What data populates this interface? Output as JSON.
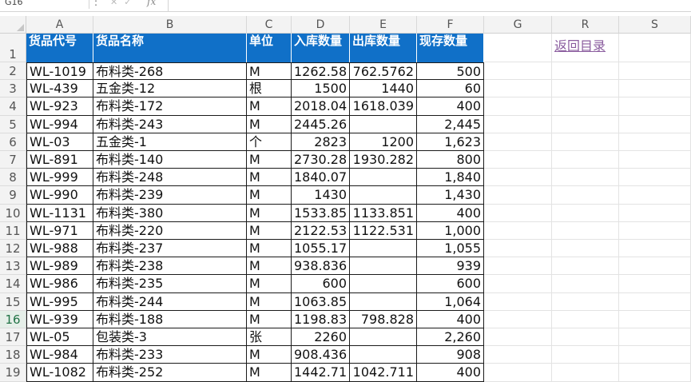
{
  "formula_bar": {
    "cell_ref": "G16",
    "fx": "fx",
    "formula": ""
  },
  "columns": [
    "A",
    "B",
    "C",
    "D",
    "E",
    "F",
    "G",
    "R",
    "S"
  ],
  "headers": [
    "货品代号",
    "货品名称",
    "单位",
    "入库数量",
    "出库数量",
    "现存数量"
  ],
  "link_text": "返回目录",
  "active_row": 16,
  "rows": [
    {
      "n": "2",
      "code": "WL-1019",
      "name": "布料类-268",
      "unit": "M",
      "in": "1262.58",
      "out": "762.5762",
      "stock": "500"
    },
    {
      "n": "3",
      "code": "WL-439",
      "name": "五金类-12",
      "unit": "根",
      "in": "1500",
      "out": "1440",
      "stock": "60"
    },
    {
      "n": "4",
      "code": "WL-923",
      "name": "布料类-172",
      "unit": "M",
      "in": "2018.04",
      "out": "1618.039",
      "stock": "400"
    },
    {
      "n": "5",
      "code": "WL-994",
      "name": "布料类-243",
      "unit": "M",
      "in": "2445.26",
      "out": "",
      "stock": "2,445"
    },
    {
      "n": "6",
      "code": "WL-03",
      "name": "五金类-1",
      "unit": "个",
      "in": "2823",
      "out": "1200",
      "stock": "1,623"
    },
    {
      "n": "7",
      "code": "WL-891",
      "name": "布料类-140",
      "unit": "M",
      "in": "2730.28",
      "out": "1930.282",
      "stock": "800"
    },
    {
      "n": "8",
      "code": "WL-999",
      "name": "布料类-248",
      "unit": "M",
      "in": "1840.07",
      "out": "",
      "stock": "1,840"
    },
    {
      "n": "9",
      "code": "WL-990",
      "name": "布料类-239",
      "unit": "M",
      "in": "1430",
      "out": "",
      "stock": "1,430"
    },
    {
      "n": "10",
      "code": "WL-1131",
      "name": "布料类-380",
      "unit": "M",
      "in": "1533.85",
      "out": "1133.851",
      "stock": "400"
    },
    {
      "n": "11",
      "code": "WL-971",
      "name": "布料类-220",
      "unit": "M",
      "in": "2122.53",
      "out": "1122.531",
      "stock": "1,000"
    },
    {
      "n": "12",
      "code": "WL-988",
      "name": "布料类-237",
      "unit": "M",
      "in": "1055.17",
      "out": "",
      "stock": "1,055"
    },
    {
      "n": "13",
      "code": "WL-989",
      "name": "布料类-238",
      "unit": "M",
      "in": "938.836",
      "out": "",
      "stock": "939"
    },
    {
      "n": "14",
      "code": "WL-986",
      "name": "布料类-235",
      "unit": "M",
      "in": "600",
      "out": "",
      "stock": "600"
    },
    {
      "n": "15",
      "code": "WL-995",
      "name": "布料类-244",
      "unit": "M",
      "in": "1063.85",
      "out": "",
      "stock": "1,064"
    },
    {
      "n": "16",
      "code": "WL-939",
      "name": "布料类-188",
      "unit": "M",
      "in": "1198.83",
      "out": "798.828",
      "stock": "400"
    },
    {
      "n": "17",
      "code": "WL-05",
      "name": "包装类-3",
      "unit": "张",
      "in": "2260",
      "out": "",
      "stock": "2,260"
    },
    {
      "n": "18",
      "code": "WL-984",
      "name": "布料类-233",
      "unit": "M",
      "in": "908.436",
      "out": "",
      "stock": "908"
    },
    {
      "n": "19",
      "code": "WL-1082",
      "name": "布料类-252",
      "unit": "M",
      "in": "1442.71",
      "out": "1042.711",
      "stock": "400"
    }
  ]
}
